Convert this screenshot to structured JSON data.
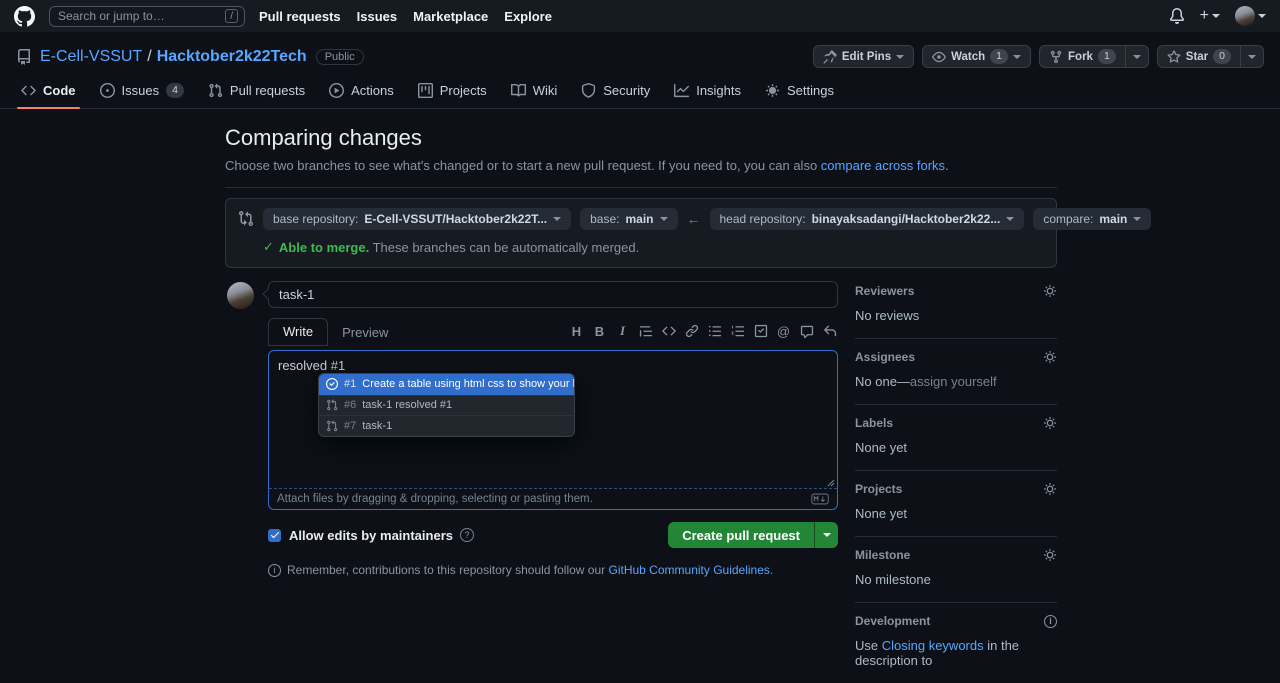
{
  "colors": {
    "accent_blue": "#58a6ff",
    "success_green": "#3fb950",
    "button_green": "#238636",
    "selection_blue": "#316dca",
    "tab_underline_orange": "#f78166",
    "header_bg": "#161b22",
    "page_bg": "#0d1117"
  },
  "header": {
    "search": {
      "placeholder": "Search or jump to…",
      "key_hint": "/"
    },
    "nav": [
      {
        "label": "Pull requests"
      },
      {
        "label": "Issues"
      },
      {
        "label": "Marketplace"
      },
      {
        "label": "Explore"
      }
    ]
  },
  "repo": {
    "owner": "E-Cell-VSSUT",
    "separator": "/",
    "name": "Hacktober2k22Tech",
    "visibility": "Public",
    "actions": {
      "edit_pins_label": "Edit Pins",
      "watch_label": "Watch",
      "watch_count": "1",
      "fork_label": "Fork",
      "fork_count": "1",
      "star_label": "Star",
      "star_count": "0"
    },
    "tabs": [
      {
        "label": "Code"
      },
      {
        "label": "Issues",
        "badge": "4"
      },
      {
        "label": "Pull requests"
      },
      {
        "label": "Actions"
      },
      {
        "label": "Projects"
      },
      {
        "label": "Wiki"
      },
      {
        "label": "Security"
      },
      {
        "label": "Insights"
      },
      {
        "label": "Settings"
      }
    ]
  },
  "compare": {
    "title": "Comparing changes",
    "description": "Choose two branches to see what's changed or to start a new pull request. If you need to, you can also ",
    "link": "compare across forks",
    "period": ".",
    "base_repo_label": "base repository:",
    "base_repo_value": "E-Cell-VSSUT/Hacktober2k22T...",
    "base_label": "base:",
    "base_value": "main",
    "head_repo_label": "head repository:",
    "head_repo_value": "binayaksadangi/Hacktober2k22...",
    "compare_label": "compare:",
    "compare_value": "main",
    "merge_ok_bold": "Able to merge.",
    "merge_ok_rest": " These branches can be automatically merged."
  },
  "pr_form": {
    "title_value": "task-1",
    "write_tab": "Write",
    "preview_tab": "Preview",
    "toolbar_icons": [
      "heading-icon",
      "bold-icon",
      "italic-icon",
      "quote-icon",
      "code-icon",
      "link-icon",
      "unordered-list-icon",
      "ordered-list-icon",
      "tasklist-icon",
      "mention-icon",
      "cross-reference-icon",
      "reply-icon"
    ],
    "body_text": "resolved #1",
    "suggestions": [
      {
        "icon": "issue-closed-icon",
        "number": "#1",
        "text": "Create a table using html css to show your bio data"
      },
      {
        "icon": "pull-request-icon",
        "number": "#6",
        "text": "task-1 resolved #1"
      },
      {
        "icon": "pull-request-icon",
        "number": "#7",
        "text": "task-1"
      }
    ],
    "attach_hint": "Attach files by dragging & dropping, selecting or pasting them.",
    "allow_edits": "Allow edits by maintainers",
    "create_button": "Create pull request",
    "note_prefix": "Remember, contributions to this repository should follow our ",
    "note_link": "GitHub Community Guidelines",
    "note_period": "."
  },
  "sidebar": {
    "reviewers": {
      "title": "Reviewers",
      "value": "No reviews"
    },
    "assignees": {
      "title": "Assignees",
      "value_strong": "No one—",
      "value_muted": "assign yourself"
    },
    "labels": {
      "title": "Labels",
      "value": "None yet"
    },
    "projects": {
      "title": "Projects",
      "value": "None yet"
    },
    "milestone": {
      "title": "Milestone",
      "value": "No milestone"
    },
    "development": {
      "title": "Development",
      "text_prefix": "Use ",
      "text_link": "Closing keywords",
      "text_suffix": " in the description to"
    }
  }
}
